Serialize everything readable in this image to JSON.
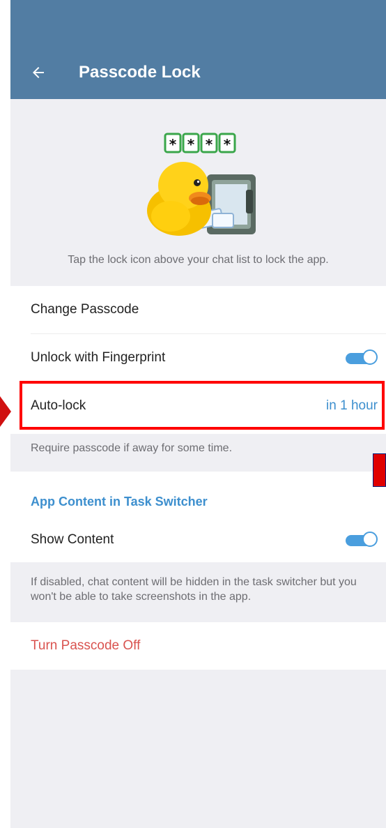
{
  "header": {
    "title": "Passcode Lock",
    "back_icon": "arrow-left-icon",
    "bar_color": "#527da3"
  },
  "hero": {
    "illustration": "duck-with-safe-illustration",
    "passcode_masks": [
      "*",
      "*",
      "*",
      "*"
    ],
    "description": "Tap the lock icon above your chat list to lock the app."
  },
  "settings": {
    "change_passcode": "Change Passcode",
    "unlock_fingerprint": {
      "label": "Unlock with Fingerprint",
      "enabled": true
    },
    "auto_lock": {
      "label": "Auto-lock",
      "value": "in 1 hour"
    },
    "auto_lock_hint": "Require passcode if away for some time."
  },
  "app_content": {
    "section_title": "App Content in Task Switcher",
    "show_content": {
      "label": "Show Content",
      "enabled": true
    },
    "hint": "If disabled, chat content will be hidden in the task switcher but you won't be able to take screenshots in the app."
  },
  "turn_off": {
    "label": "Turn Passcode Off",
    "color": "#d9534f"
  },
  "colors": {
    "accent": "#3d8fce",
    "toggle": "#4a9ede",
    "highlight": "#ff0000"
  }
}
